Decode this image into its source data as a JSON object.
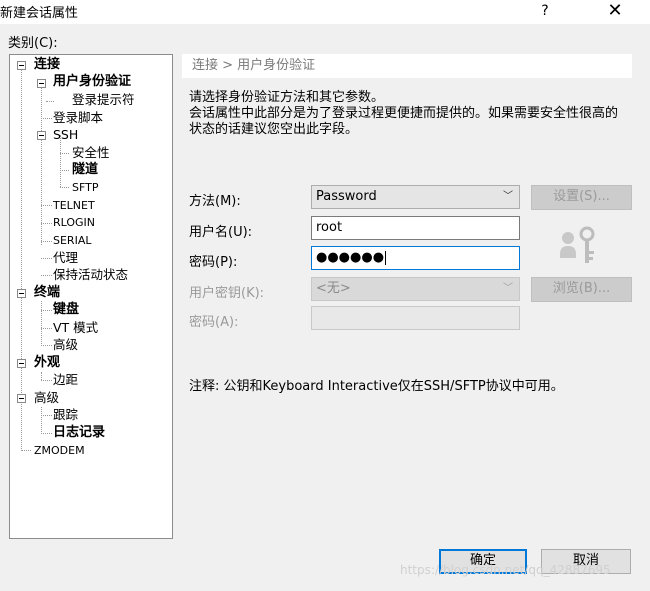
{
  "window": {
    "title": "新建会话属性",
    "help": "?",
    "close": "✕"
  },
  "category_label": "类别(C):",
  "tree": {
    "connection": "连接",
    "user_auth": "用户身份验证",
    "login_prompt": "登录提示符",
    "login_script": "登录脚本",
    "ssh": "SSH",
    "security": "安全性",
    "tunnel": "隧道",
    "sftp": "SFTP",
    "telnet": "TELNET",
    "rlogin": "RLOGIN",
    "serial": "SERIAL",
    "proxy": "代理",
    "keep_alive": "保持活动状态",
    "terminal": "终端",
    "keyboard": "键盘",
    "vt_mode": "VT 模式",
    "advanced": "高级",
    "appearance": "外观",
    "margin": "边距",
    "advanced2": "高级",
    "trace": "跟踪",
    "logging": "日志记录",
    "zmodem": "ZMODEM"
  },
  "panel": {
    "breadcrumb": "连接 > 用户身份验证",
    "intro": "请选择身份验证方法和其它参数。",
    "description": "会话属性中此部分是为了登录过程更便捷而提供的。如果需要安全性很高的状态的话建议您空出此字段。",
    "method_label": "方法(M):",
    "method_value": "Password",
    "username_label": "用户名(U):",
    "username_value": "root",
    "password_label": "密码(P):",
    "password_value": "●●●●●●",
    "user_key_label": "用户密钥(K):",
    "user_key_value": "<无>",
    "passphrase_label": "密码(A):",
    "settings_button": "设置(S)...",
    "browse_button": "浏览(B)...",
    "note": "注释: 公钥和Keyboard Interactive仅在SSH/SFTP协议中可用。"
  },
  "footer": {
    "ok_button": "确定",
    "cancel_button": "取消",
    "watermark": "https://blog.csdn.net/qq_42887695"
  },
  "colors": {
    "accent": "#0078d7",
    "background": "#f0f0f0"
  }
}
